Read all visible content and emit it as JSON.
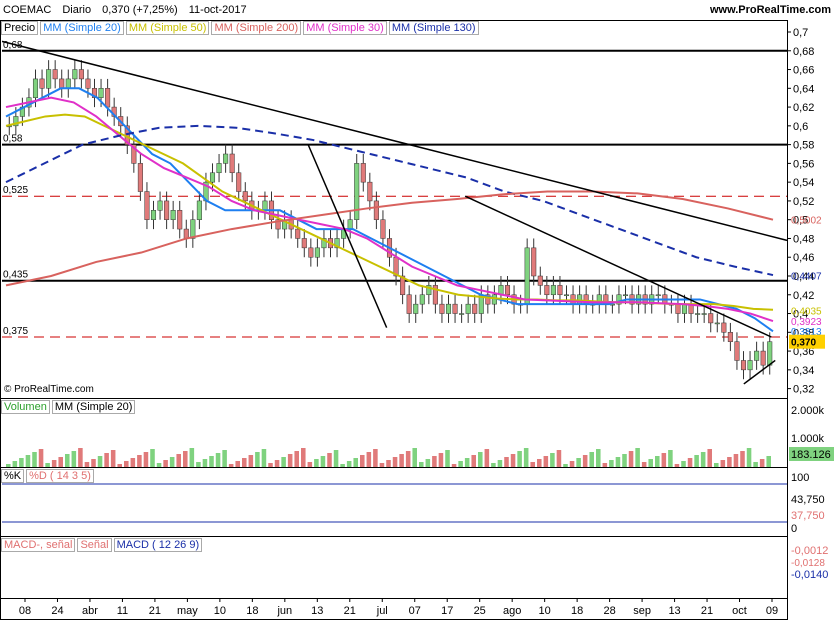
{
  "header": {
    "symbol": "COEMAC",
    "period": "Diario",
    "last": "0,370 (+7,25%)",
    "date": "11-oct-2017",
    "site": "www.ProRealTime.com"
  },
  "copyright": "© ProRealTime.com",
  "price_legend": [
    {
      "label": "Precio",
      "color": "#000000"
    },
    {
      "label": "MM (Simple 20)",
      "color": "#1e7ff0"
    },
    {
      "label": "MM (Simple 50)",
      "color": "#c8c000"
    },
    {
      "label": "MM (Simple 200)",
      "color": "#d8625e"
    },
    {
      "label": "MM (Simple 30)",
      "color": "#e030c8"
    },
    {
      "label": "MM (Simple 130)",
      "color": "#1a2fa8"
    }
  ],
  "volume_legend": [
    {
      "label": "Volumen",
      "color": "#2ca02c"
    },
    {
      "label": "MM (Simple 20)",
      "color": "#000000"
    }
  ],
  "stoch_legend": [
    {
      "label": "%K",
      "color": "#000000"
    },
    {
      "label": "%D ( 14 3 5)",
      "color": "#e07070"
    }
  ],
  "macd_legend": [
    {
      "label": "MACD-, señal",
      "color": "#e07070"
    },
    {
      "label": "Señal",
      "color": "#e07070"
    },
    {
      "label": "MACD ( 12 26 9)",
      "color": "#1a2fa8"
    }
  ],
  "chart_data": [
    {
      "type": "candlestick",
      "title": "COEMAC Diario",
      "ylim": [
        0.31,
        0.7
      ],
      "y_ticks": [
        "0,7",
        "0,68",
        "0,66",
        "0,64",
        "0,62",
        "0,6",
        "0,58",
        "0,56",
        "0,54",
        "0,52",
        "0,5",
        "0,48",
        "0,46",
        "0,44",
        "0,42",
        "0,4",
        "0,38",
        "0,36",
        "0,34",
        "0,32"
      ],
      "x_ticks": [
        "08",
        "24",
        "abr",
        "11",
        "21",
        "may",
        "10",
        "18",
        "jun",
        "13",
        "21",
        "jul",
        "07",
        "17",
        "25",
        "ago",
        "10",
        "18",
        "28",
        "sep",
        "13",
        "21",
        "oct",
        "09"
      ],
      "horizontal_levels": [
        {
          "value": 0.68,
          "label": "0,68",
          "style": "solid"
        },
        {
          "value": 0.58,
          "label": "0,58",
          "style": "solid"
        },
        {
          "value": 0.525,
          "label": "0,525",
          "style": "dashed"
        },
        {
          "value": 0.435,
          "label": "0,435",
          "style": "solid"
        },
        {
          "value": 0.375,
          "label": "0,375",
          "style": "dashed"
        }
      ],
      "right_labels": [
        {
          "value": "0,5002",
          "color": "#d8625e",
          "y": 0.5002
        },
        {
          "value": "0,4407",
          "color": "#1a2fa8",
          "y": 0.4407
        },
        {
          "value": "0,4035",
          "color": "#c8c000",
          "y": 0.4035
        },
        {
          "value": "0,3923",
          "color": "#e030c8",
          "y": 0.3923
        },
        {
          "value": "0,3813",
          "color": "#1e7ff0",
          "y": 0.3813
        },
        {
          "value": "0,370",
          "color": "#000000",
          "y": 0.37,
          "highlight": true
        }
      ],
      "close": [
        0.6,
        0.61,
        0.62,
        0.63,
        0.65,
        0.64,
        0.66,
        0.65,
        0.64,
        0.65,
        0.66,
        0.65,
        0.64,
        0.63,
        0.64,
        0.62,
        0.61,
        0.6,
        0.58,
        0.56,
        0.53,
        0.5,
        0.51,
        0.52,
        0.5,
        0.51,
        0.49,
        0.48,
        0.5,
        0.52,
        0.54,
        0.55,
        0.56,
        0.57,
        0.55,
        0.53,
        0.52,
        0.51,
        0.51,
        0.52,
        0.5,
        0.49,
        0.5,
        0.49,
        0.48,
        0.47,
        0.46,
        0.47,
        0.48,
        0.47,
        0.48,
        0.49,
        0.5,
        0.56,
        0.54,
        0.52,
        0.5,
        0.48,
        0.46,
        0.44,
        0.42,
        0.4,
        0.41,
        0.42,
        0.43,
        0.41,
        0.4,
        0.41,
        0.4,
        0.4,
        0.41,
        0.4,
        0.42,
        0.41,
        0.42,
        0.43,
        0.42,
        0.41,
        0.41,
        0.47,
        0.44,
        0.43,
        0.42,
        0.43,
        0.42,
        0.42,
        0.41,
        0.42,
        0.41,
        0.41,
        0.42,
        0.41,
        0.41,
        0.42,
        0.42,
        0.41,
        0.42,
        0.41,
        0.42,
        0.42,
        0.41,
        0.41,
        0.4,
        0.41,
        0.4,
        0.4,
        0.4,
        0.39,
        0.39,
        0.38,
        0.37,
        0.35,
        0.34,
        0.35,
        0.36,
        0.345,
        0.37
      ],
      "series": [
        {
          "name": "MM (Simple 20)",
          "color": "#1e7ff0",
          "values": [
            0.61,
            0.62,
            0.63,
            0.64,
            0.64,
            0.63,
            0.61,
            0.59,
            0.57,
            0.56,
            0.54,
            0.52,
            0.51,
            0.51,
            0.51,
            0.51,
            0.5,
            0.49,
            0.49,
            0.49,
            0.48,
            0.47,
            0.46,
            0.45,
            0.44,
            0.43,
            0.42,
            0.415,
            0.41,
            0.41,
            0.41,
            0.41,
            0.41,
            0.41,
            0.415,
            0.415,
            0.415,
            0.415,
            0.415,
            0.41,
            0.405,
            0.395,
            0.381
          ]
        },
        {
          "name": "MM (Simple 50)",
          "color": "#c8c000",
          "values": [
            0.6,
            0.605,
            0.61,
            0.612,
            0.61,
            0.6,
            0.59,
            0.58,
            0.57,
            0.56,
            0.545,
            0.53,
            0.52,
            0.51,
            0.5,
            0.49,
            0.48,
            0.47,
            0.46,
            0.45,
            0.44,
            0.43,
            0.425,
            0.42,
            0.418,
            0.416,
            0.415,
            0.415,
            0.414,
            0.414,
            0.413,
            0.412,
            0.412,
            0.411,
            0.41,
            0.41,
            0.41,
            0.408,
            0.405,
            0.404
          ]
        },
        {
          "name": "MM (Simple 30)",
          "color": "#e030c8",
          "values": [
            0.62,
            0.625,
            0.63,
            0.625,
            0.61,
            0.59,
            0.57,
            0.555,
            0.545,
            0.535,
            0.52,
            0.51,
            0.505,
            0.5,
            0.495,
            0.49,
            0.48,
            0.465,
            0.45,
            0.44,
            0.43,
            0.425,
            0.42,
            0.415,
            0.414,
            0.413,
            0.412,
            0.412,
            0.412,
            0.411,
            0.41,
            0.408,
            0.405,
            0.4,
            0.392
          ]
        },
        {
          "name": "MM (Simple 130)",
          "color": "#1a2fa8",
          "values": [
            0.54,
            0.56,
            0.58,
            0.59,
            0.598,
            0.6,
            0.598,
            0.592,
            0.585,
            0.575,
            0.565,
            0.555,
            0.545,
            0.53,
            0.52,
            0.505,
            0.49,
            0.475,
            0.46,
            0.45,
            0.441
          ]
        },
        {
          "name": "MM (Simple 200)",
          "color": "#d8625e",
          "values": [
            0.43,
            0.44,
            0.455,
            0.465,
            0.48,
            0.49,
            0.498,
            0.505,
            0.512,
            0.518,
            0.522,
            0.527,
            0.53,
            0.53,
            0.528,
            0.522,
            0.512,
            0.5
          ]
        }
      ]
    },
    {
      "type": "bar",
      "title": "Volumen",
      "y_ticks": [
        "2.000k",
        "1.000k"
      ],
      "last_label": "183.126",
      "ylim": [
        0,
        2400
      ]
    },
    {
      "type": "line",
      "title": "Stochastic",
      "y_ticks": [
        "100",
        "0"
      ],
      "ylim": [
        0,
        100
      ],
      "last_labels": [
        "43,750",
        "37,750"
      ]
    },
    {
      "type": "line",
      "title": "MACD",
      "last_labels": [
        "-0,0012",
        "-0,0140"
      ],
      "extra_label": "-0,0128"
    }
  ]
}
